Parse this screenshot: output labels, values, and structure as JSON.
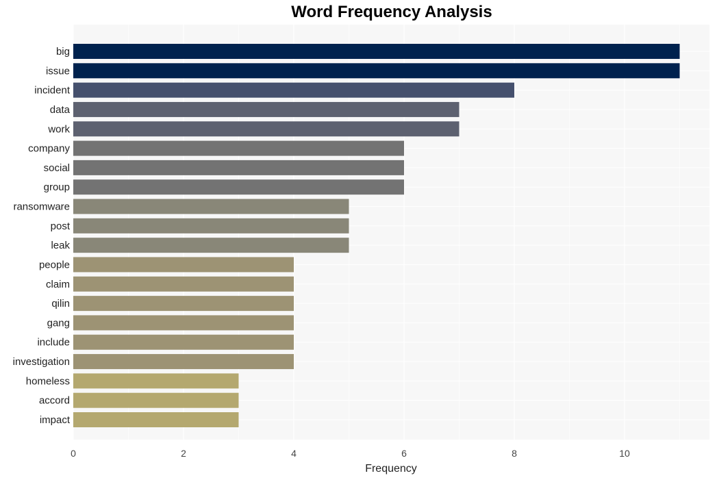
{
  "chart_data": {
    "type": "bar",
    "orientation": "horizontal",
    "title": "Word Frequency Analysis",
    "xlabel": "Frequency",
    "ylabel": "",
    "xlim": [
      0,
      11.55
    ],
    "xticks": [
      0,
      2,
      4,
      6,
      8,
      10
    ],
    "grid": true,
    "legend": "none",
    "categories": [
      "big",
      "issue",
      "incident",
      "data",
      "work",
      "company",
      "social",
      "group",
      "ransomware",
      "post",
      "leak",
      "people",
      "claim",
      "qilin",
      "gang",
      "include",
      "investigation",
      "homeless",
      "accord",
      "impact"
    ],
    "values": [
      11,
      11,
      8,
      7,
      7,
      6,
      6,
      6,
      5,
      5,
      5,
      4,
      4,
      4,
      4,
      4,
      4,
      3,
      3,
      3
    ],
    "colors": [
      "#00224e",
      "#00224e",
      "#45506d",
      "#5d6170",
      "#5d6170",
      "#737373",
      "#737373",
      "#737373",
      "#898778",
      "#898778",
      "#898778",
      "#9d9374",
      "#9d9374",
      "#9d9374",
      "#9d9374",
      "#9d9374",
      "#9d9374",
      "#b4a86f",
      "#b4a86f",
      "#b4a86f"
    ]
  }
}
